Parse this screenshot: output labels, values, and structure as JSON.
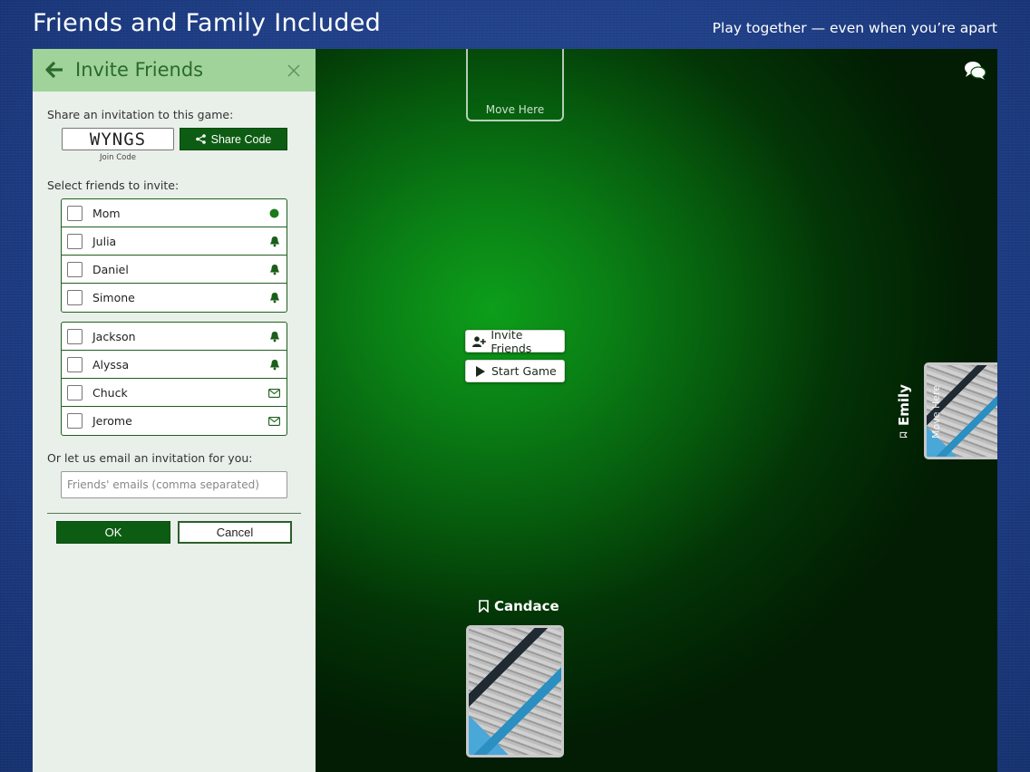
{
  "header": {
    "title": "Friends and Family Included",
    "tagline": "Play together — even when you’re apart"
  },
  "panel": {
    "title": "Invite Friends",
    "share_label": "Share an invitation to this game:",
    "join_code": "WYNGS",
    "join_code_caption": "Join Code",
    "share_code_button": "Share Code",
    "select_label": "Select friends to invite:",
    "friend_groups": [
      [
        {
          "name": "Mom",
          "status": "online-dot-icon"
        },
        {
          "name": "Julia",
          "status": "bell-icon"
        },
        {
          "name": "Daniel",
          "status": "bell-icon"
        },
        {
          "name": "Simone",
          "status": "bell-icon"
        }
      ],
      [
        {
          "name": "Jackson",
          "status": "bell-icon"
        },
        {
          "name": "Alyssa",
          "status": "bell-icon"
        },
        {
          "name": "Chuck",
          "status": "envelope-icon"
        },
        {
          "name": "Jerome",
          "status": "envelope-icon"
        }
      ]
    ],
    "email_label": "Or let us email an invitation for you:",
    "email_placeholder": "Friends' emails (comma separated)",
    "ok_button": "OK",
    "cancel_button": "Cancel"
  },
  "game": {
    "top_slot_label": "Move Here",
    "invite_button": "Invite Friends",
    "start_button": "Start Game",
    "player_bottom": "Candace",
    "player_right": "Emily",
    "right_slot_label": "Move Here"
  },
  "colors": {
    "brand_green": "#0d5c13",
    "panel_header": "#9fd39a",
    "background_blue": "#1f3f86",
    "status_green": "#1b7a1b"
  }
}
